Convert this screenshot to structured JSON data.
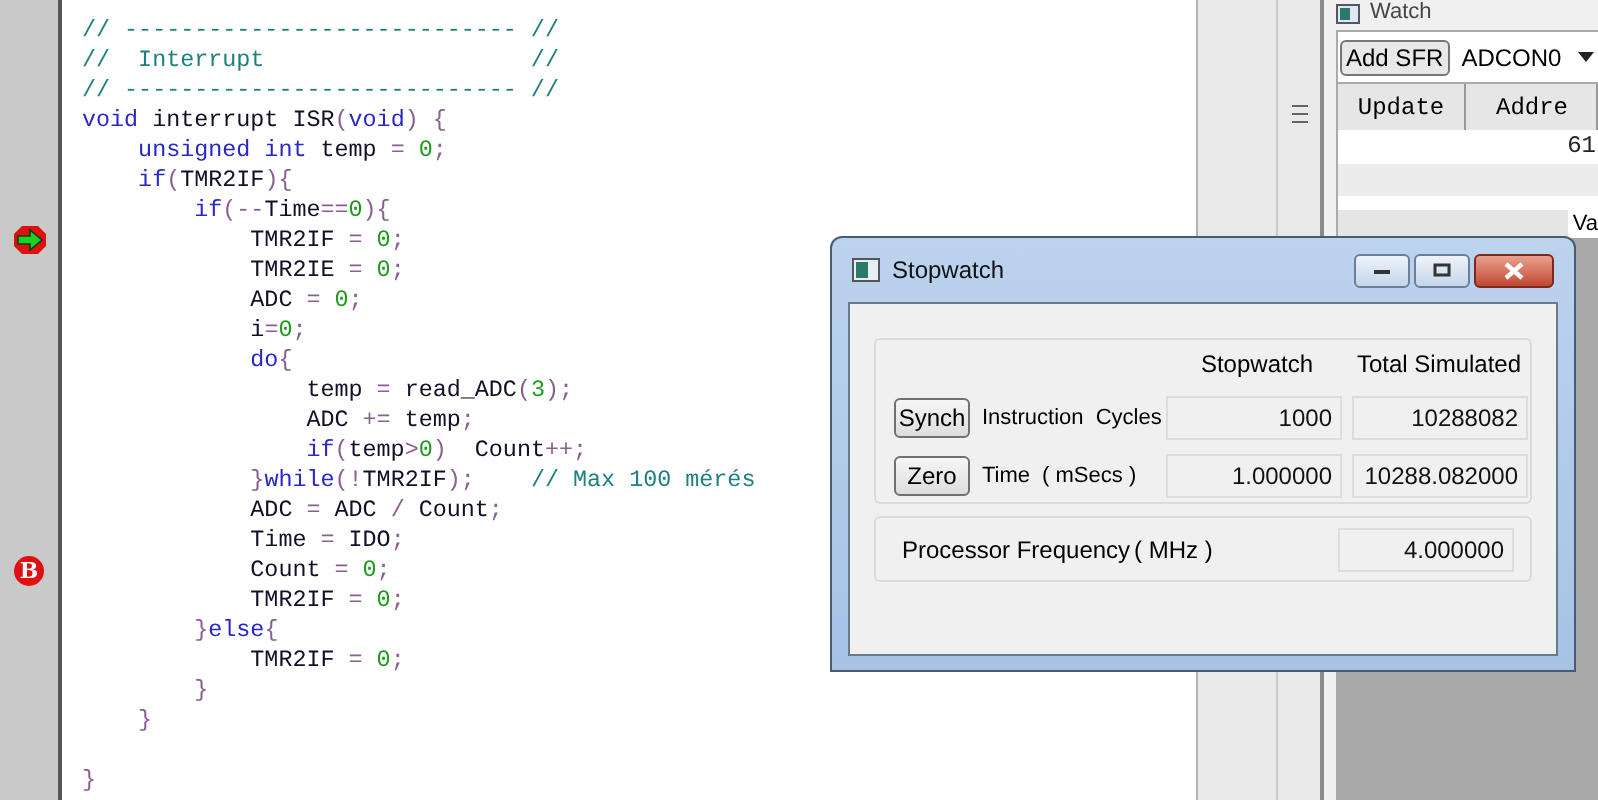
{
  "editor": {
    "lines": [
      {
        "tokens": [
          {
            "text": "// ---------------------------- //",
            "kind": "cm"
          }
        ]
      },
      {
        "tokens": [
          {
            "text": "//  Interrupt                   //",
            "kind": "cm"
          }
        ]
      },
      {
        "tokens": [
          {
            "text": "// ---------------------------- //",
            "kind": "cm"
          }
        ]
      },
      {
        "tokens": [
          {
            "text": "void",
            "kind": "kw"
          },
          {
            "text": " interrupt ISR",
            "kind": "id"
          },
          {
            "text": "(",
            "kind": "op"
          },
          {
            "text": "void",
            "kind": "kw"
          },
          {
            "text": ") {",
            "kind": "op"
          }
        ]
      },
      {
        "tokens": [
          {
            "text": "    unsigned int",
            "kind": "kw"
          },
          {
            "text": " temp ",
            "kind": "id"
          },
          {
            "text": "= ",
            "kind": "op"
          },
          {
            "text": "0",
            "kind": "num"
          },
          {
            "text": ";",
            "kind": "op"
          }
        ]
      },
      {
        "tokens": [
          {
            "text": "    if",
            "kind": "kw"
          },
          {
            "text": "(",
            "kind": "op"
          },
          {
            "text": "TMR2IF",
            "kind": "id"
          },
          {
            "text": "){",
            "kind": "op"
          }
        ]
      },
      {
        "tokens": [
          {
            "text": "        if",
            "kind": "kw"
          },
          {
            "text": "(--",
            "kind": "op"
          },
          {
            "text": "Time",
            "kind": "id"
          },
          {
            "text": "==",
            "kind": "op"
          },
          {
            "text": "0",
            "kind": "num"
          },
          {
            "text": "){",
            "kind": "op"
          }
        ]
      },
      {
        "tokens": [
          {
            "text": "            TMR2IF ",
            "kind": "id"
          },
          {
            "text": "= ",
            "kind": "op"
          },
          {
            "text": "0",
            "kind": "num"
          },
          {
            "text": ";",
            "kind": "op"
          }
        ],
        "marker": {
          "kind": "current"
        }
      },
      {
        "tokens": [
          {
            "text": "            TMR2IE ",
            "kind": "id"
          },
          {
            "text": "= ",
            "kind": "op"
          },
          {
            "text": "0",
            "kind": "num"
          },
          {
            "text": ";",
            "kind": "op"
          }
        ]
      },
      {
        "tokens": [
          {
            "text": "            ADC ",
            "kind": "id"
          },
          {
            "text": "= ",
            "kind": "op"
          },
          {
            "text": "0",
            "kind": "num"
          },
          {
            "text": ";",
            "kind": "op"
          }
        ]
      },
      {
        "tokens": [
          {
            "text": "            i",
            "kind": "id"
          },
          {
            "text": "=",
            "kind": "op"
          },
          {
            "text": "0",
            "kind": "num"
          },
          {
            "text": ";",
            "kind": "op"
          }
        ]
      },
      {
        "tokens": [
          {
            "text": "            do",
            "kind": "kw"
          },
          {
            "text": "{",
            "kind": "op"
          }
        ]
      },
      {
        "tokens": [
          {
            "text": "                temp ",
            "kind": "id"
          },
          {
            "text": "= ",
            "kind": "op"
          },
          {
            "text": "read_ADC",
            "kind": "id"
          },
          {
            "text": "(",
            "kind": "op"
          },
          {
            "text": "3",
            "kind": "num"
          },
          {
            "text": ");",
            "kind": "op"
          }
        ]
      },
      {
        "tokens": [
          {
            "text": "                ADC ",
            "kind": "id"
          },
          {
            "text": "+= ",
            "kind": "op"
          },
          {
            "text": "temp",
            "kind": "id"
          },
          {
            "text": ";",
            "kind": "op"
          }
        ]
      },
      {
        "tokens": [
          {
            "text": "                if",
            "kind": "kw"
          },
          {
            "text": "(",
            "kind": "op"
          },
          {
            "text": "temp",
            "kind": "id"
          },
          {
            "text": ">",
            "kind": "op"
          },
          {
            "text": "0",
            "kind": "num"
          },
          {
            "text": ")  ",
            "kind": "op"
          },
          {
            "text": "Count",
            "kind": "id"
          },
          {
            "text": "++;",
            "kind": "op"
          }
        ]
      },
      {
        "tokens": [
          {
            "text": "            }",
            "kind": "op"
          },
          {
            "text": "while",
            "kind": "kw"
          },
          {
            "text": "(!",
            "kind": "op"
          },
          {
            "text": "TMR2IF",
            "kind": "id"
          },
          {
            "text": ");    ",
            "kind": "op"
          },
          {
            "text": "// Max 100 mérés",
            "kind": "cm"
          }
        ]
      },
      {
        "tokens": [
          {
            "text": "            ADC ",
            "kind": "id"
          },
          {
            "text": "= ",
            "kind": "op"
          },
          {
            "text": "ADC ",
            "kind": "id"
          },
          {
            "text": "/ ",
            "kind": "op"
          },
          {
            "text": "Count",
            "kind": "id"
          },
          {
            "text": ";",
            "kind": "op"
          }
        ]
      },
      {
        "tokens": [
          {
            "text": "            Time ",
            "kind": "id"
          },
          {
            "text": "= ",
            "kind": "op"
          },
          {
            "text": "IDO",
            "kind": "id"
          },
          {
            "text": ";",
            "kind": "op"
          }
        ]
      },
      {
        "tokens": [
          {
            "text": "            Count ",
            "kind": "id"
          },
          {
            "text": "= ",
            "kind": "op"
          },
          {
            "text": "0",
            "kind": "num"
          },
          {
            "text": ";",
            "kind": "op"
          }
        ],
        "marker": {
          "kind": "breakpoint",
          "label": "B"
        }
      },
      {
        "tokens": [
          {
            "text": "            TMR2IF ",
            "kind": "id"
          },
          {
            "text": "= ",
            "kind": "op"
          },
          {
            "text": "0",
            "kind": "num"
          },
          {
            "text": ";",
            "kind": "op"
          }
        ]
      },
      {
        "tokens": [
          {
            "text": "        }",
            "kind": "op"
          },
          {
            "text": "else",
            "kind": "kw"
          },
          {
            "text": "{",
            "kind": "op"
          }
        ]
      },
      {
        "tokens": [
          {
            "text": "            TMR2IF ",
            "kind": "id"
          },
          {
            "text": "= ",
            "kind": "op"
          },
          {
            "text": "0",
            "kind": "num"
          },
          {
            "text": ";",
            "kind": "op"
          }
        ]
      },
      {
        "tokens": [
          {
            "text": "        }",
            "kind": "op"
          }
        ]
      },
      {
        "tokens": [
          {
            "text": "    }",
            "kind": "op"
          }
        ]
      },
      {
        "tokens": [
          {
            "text": "}",
            "kind": "op"
          }
        ],
        "blank_before": true
      }
    ]
  },
  "watch": {
    "title": "Watch",
    "add_button": "Add SFR",
    "sfr_select": "ADCON0",
    "columns": [
      "Update",
      "Addre"
    ],
    "rows": [
      {
        "address": "61"
      }
    ],
    "tab": "Va"
  },
  "stopwatch": {
    "title": "Stopwatch",
    "columns": [
      "Stopwatch",
      "Total Simulated"
    ],
    "rows": [
      {
        "button": "Synch",
        "label": "Instruction  Cycles",
        "values": [
          "1000",
          "10288082"
        ]
      },
      {
        "button": "Zero",
        "label": "Time",
        "unit": "( mSecs )",
        "values": [
          "1.000000",
          "10288.082000"
        ]
      }
    ],
    "frequency": {
      "label": "Processor Frequency",
      "unit": "( MHz )",
      "value": "4.000000"
    }
  }
}
